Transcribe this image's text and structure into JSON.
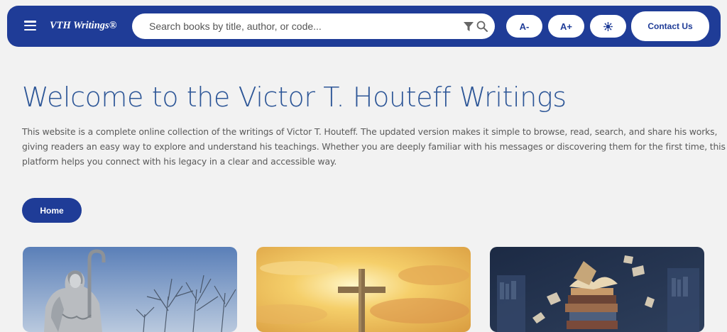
{
  "header": {
    "menu_icon": "hamburger-menu-icon",
    "brand": "VTH Writings®",
    "search": {
      "placeholder": "Search books by title, author, or code...",
      "value": "",
      "filter_icon": "filter-funnel-icon",
      "search_icon": "magnifier-icon"
    },
    "font_decrease_label": "A-",
    "font_increase_label": "A+",
    "theme_icon": "sun-gear-icon",
    "contact_label": "Contact Us"
  },
  "main": {
    "title": "Welcome to the Victor T. Houteff Writings",
    "intro": "This website is a complete online collection of the writings of Victor T. Houteff. The updated version makes it simple to browse, read, search, and share his works, giving readers an easy way to explore and understand his teachings. Whether you are deeply familiar with his messages or discovering them for the first time, this platform helps you connect with his legacy in a clear and accessible way.",
    "home_label": "Home"
  },
  "cards": [
    {
      "image": "shepherd-statue-image"
    },
    {
      "image": "cross-sunset-image"
    },
    {
      "image": "flying-books-image"
    }
  ],
  "colors": {
    "brand_blue": "#1f3c97",
    "title_blue": "#2d5697",
    "page_bg": "#f2f2f2",
    "text_gray": "#5a5a5a"
  }
}
